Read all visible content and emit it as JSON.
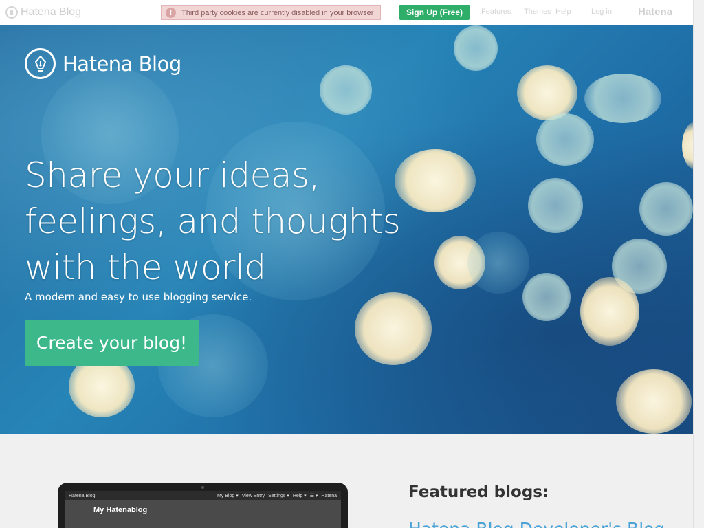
{
  "topbar": {
    "logo_text": "Hatena Blog",
    "cookie_notice": "Third party cookies are currently disabled in your browser",
    "signup_label": "Sign Up (Free)",
    "nav": [
      "Features",
      "Themes",
      "Help"
    ],
    "login_label": "Log in",
    "hatena_label": "Hatena"
  },
  "hero": {
    "logo_text": "Hatena Blog",
    "title_lines": [
      "Share your ideas,",
      "feelings, and thoughts",
      "with the world"
    ],
    "subtitle": "A modern and easy to use blogging service.",
    "cta_label": "Create your blog!"
  },
  "preview": {
    "app_name": "Hatena Blog",
    "menu": [
      "My Blog ▾",
      "View Entry",
      "Settings ▾",
      "Help ▾",
      "☰ ▾"
    ],
    "hatena_label": "Hatena",
    "blog_title": "My Hatenablog"
  },
  "featured": {
    "title": "Featured blogs:",
    "first_link": "Hatena Blog Developer's Blog"
  },
  "colors": {
    "accent_green": "#3db88a",
    "signup_green": "#2fae6a",
    "link_blue": "#4aa3d6"
  }
}
